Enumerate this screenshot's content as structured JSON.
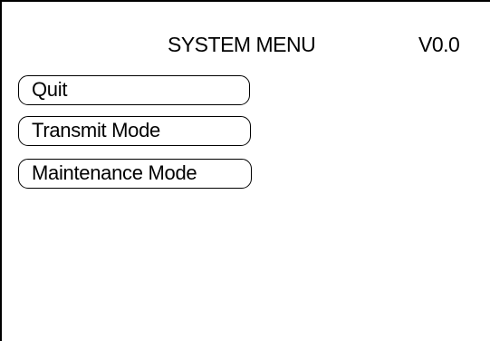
{
  "header": {
    "title": "SYSTEM MENU",
    "version": "V0.0"
  },
  "menu": {
    "items": [
      {
        "label": "Quit"
      },
      {
        "label": "Transmit Mode"
      },
      {
        "label": "Maintenance Mode"
      }
    ]
  }
}
